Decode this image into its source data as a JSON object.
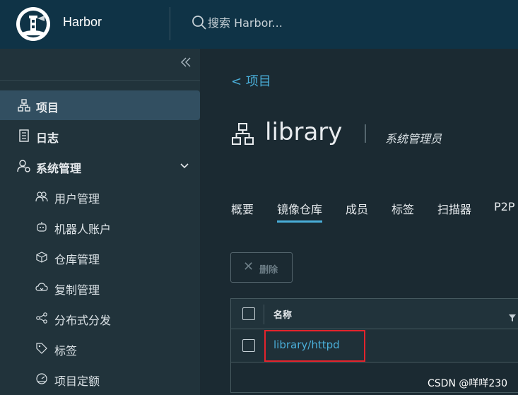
{
  "header": {
    "app_title": "Harbor",
    "search_placeholder": "搜索 Harbor..."
  },
  "sidebar": {
    "collapse_icon": "double-chevron-left-icon",
    "items": [
      {
        "label": "项目",
        "icon": "project-icon",
        "active": true
      },
      {
        "label": "日志",
        "icon": "log-icon"
      },
      {
        "label": "系统管理",
        "icon": "admin-icon",
        "expanded": true
      }
    ],
    "sub_items": [
      {
        "label": "用户管理",
        "icon": "users-icon"
      },
      {
        "label": "机器人账户",
        "icon": "robot-icon"
      },
      {
        "label": "仓库管理",
        "icon": "box-icon"
      },
      {
        "label": "复制管理",
        "icon": "cloud-replicate-icon"
      },
      {
        "label": "分布式分发",
        "icon": "share-icon"
      },
      {
        "label": "标签",
        "icon": "tag-icon"
      },
      {
        "label": "项目定额",
        "icon": "dashboard-icon"
      }
    ]
  },
  "main": {
    "back_label": "<  项目",
    "title": "library",
    "role": "系统管理员",
    "tabs": [
      {
        "label": "概要"
      },
      {
        "label": "镜像仓库",
        "active": true
      },
      {
        "label": "成员"
      },
      {
        "label": "标签"
      },
      {
        "label": "扫描器"
      },
      {
        "label": "P2P"
      }
    ],
    "delete_label": "删除",
    "table": {
      "column_name": "名称",
      "rows": [
        {
          "name": "library/httpd"
        }
      ]
    }
  },
  "watermark": "CSDN @咩咩230",
  "colors": {
    "header_bg": "#0f3346",
    "sidebar_bg": "#21333b",
    "main_bg": "#1b2a32",
    "accent": "#4aaed9",
    "highlight": "#e3232c"
  }
}
